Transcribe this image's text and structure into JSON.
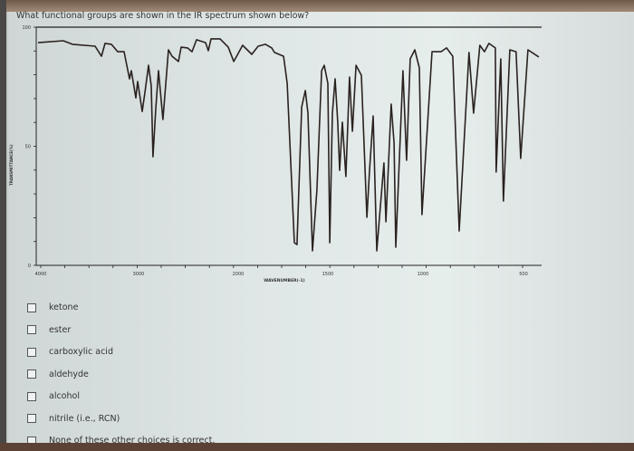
{
  "question": "What functional groups are shown in the IR spectrum shown below?",
  "options": [
    "ketone",
    "ester",
    "carboxylic acid",
    "aldehyde",
    "alcohol",
    "nitrile (i.e., RCN)",
    "None of these other choices is correct."
  ],
  "chart_data": {
    "type": "line",
    "title": "",
    "xlabel": "WAVENUMBER(-1)",
    "ylabel": "TRANSMITTANCE(%)",
    "x_ticks": [
      "4000",
      "3000",
      "2000",
      "1500",
      "1000",
      "500"
    ],
    "y_ticks": [
      "100",
      "50",
      "0"
    ],
    "xlim": [
      4000,
      500
    ],
    "ylim": [
      0,
      100
    ],
    "grid": false,
    "line_color": "#2a2220",
    "points": [
      [
        4028,
        93.5
      ],
      [
        3769,
        94.3
      ],
      [
        3676,
        92.8
      ],
      [
        3444,
        92.0
      ],
      [
        3380,
        87.8
      ],
      [
        3343,
        93.2
      ],
      [
        3278,
        92.8
      ],
      [
        3213,
        89.7
      ],
      [
        3148,
        89.7
      ],
      [
        3093,
        78.3
      ],
      [
        3074,
        81.7
      ],
      [
        3028,
        70.3
      ],
      [
        3009,
        77.2
      ],
      [
        2964,
        64.6
      ],
      [
        2936,
        72.6
      ],
      [
        2900,
        84.0
      ],
      [
        2873,
        75.3
      ],
      [
        2855,
        45.6
      ],
      [
        2827,
        65.8
      ],
      [
        2800,
        81.7
      ],
      [
        2755,
        61.2
      ],
      [
        2700,
        90.5
      ],
      [
        2664,
        87.8
      ],
      [
        2600,
        85.6
      ],
      [
        2573,
        91.6
      ],
      [
        2509,
        91.3
      ],
      [
        2464,
        89.7
      ],
      [
        2418,
        94.7
      ],
      [
        2327,
        93.5
      ],
      [
        2300,
        90.1
      ],
      [
        2273,
        95.1
      ],
      [
        2182,
        95.1
      ],
      [
        2100,
        91.6
      ],
      [
        2045,
        85.6
      ],
      [
        1975,
        92.4
      ],
      [
        1924,
        88.6
      ],
      [
        1889,
        92.0
      ],
      [
        1848,
        92.8
      ],
      [
        1813,
        91.3
      ],
      [
        1798,
        89.4
      ],
      [
        1747,
        87.8
      ],
      [
        1727,
        76.4
      ],
      [
        1687,
        9.5
      ],
      [
        1672,
        8.7
      ],
      [
        1646,
        66.5
      ],
      [
        1626,
        73.4
      ],
      [
        1611,
        63.9
      ],
      [
        1586,
        6.1
      ],
      [
        1561,
        31.6
      ],
      [
        1535,
        81.7
      ],
      [
        1520,
        84.0
      ],
      [
        1500,
        76.4
      ],
      [
        1490,
        9.5
      ],
      [
        1476,
        63.9
      ],
      [
        1462,
        78.3
      ],
      [
        1448,
        60.1
      ],
      [
        1438,
        39.9
      ],
      [
        1424,
        60.1
      ],
      [
        1405,
        37.3
      ],
      [
        1386,
        79.1
      ],
      [
        1371,
        56.3
      ],
      [
        1352,
        84.0
      ],
      [
        1324,
        79.8
      ],
      [
        1295,
        20.2
      ],
      [
        1281,
        39.9
      ],
      [
        1262,
        62.7
      ],
      [
        1243,
        6.1
      ],
      [
        1205,
        43.0
      ],
      [
        1195,
        18.3
      ],
      [
        1167,
        67.7
      ],
      [
        1152,
        51.3
      ],
      [
        1143,
        7.6
      ],
      [
        1105,
        81.7
      ],
      [
        1086,
        44.1
      ],
      [
        1067,
        86.7
      ],
      [
        1043,
        90.5
      ],
      [
        1019,
        82.9
      ],
      [
        1005,
        21.3
      ],
      [
        955,
        89.7
      ],
      [
        910,
        89.7
      ],
      [
        883,
        91.3
      ],
      [
        852,
        87.8
      ],
      [
        820,
        14.4
      ],
      [
        771,
        89.4
      ],
      [
        748,
        63.9
      ],
      [
        717,
        92.4
      ],
      [
        694,
        89.7
      ],
      [
        672,
        93.2
      ],
      [
        640,
        91.3
      ],
      [
        636,
        39.2
      ],
      [
        613,
        86.7
      ],
      [
        600,
        27.0
      ],
      [
        568,
        90.5
      ],
      [
        537,
        89.7
      ],
      [
        514,
        44.9
      ],
      [
        478,
        90.5
      ],
      [
        424,
        87.5
      ]
    ]
  }
}
